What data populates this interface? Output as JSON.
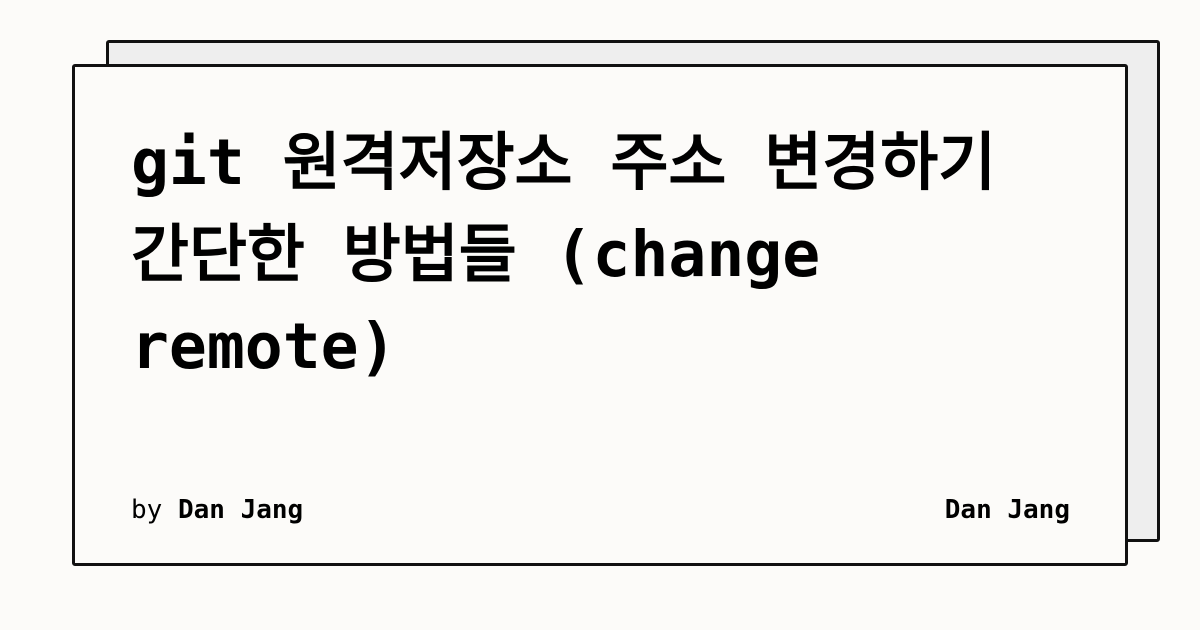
{
  "post": {
    "title": "git 원격저장소 주소 변경하기 간단한 방법들 (change remote)",
    "byline_prefix": "by",
    "author": "Dan Jang"
  },
  "site": {
    "name": "Dan Jang"
  },
  "colors": {
    "background": "#fcfbf9",
    "card_front": "#fcfbf9",
    "card_back": "#eeeeee",
    "border": "#111111",
    "text": "#000000"
  }
}
